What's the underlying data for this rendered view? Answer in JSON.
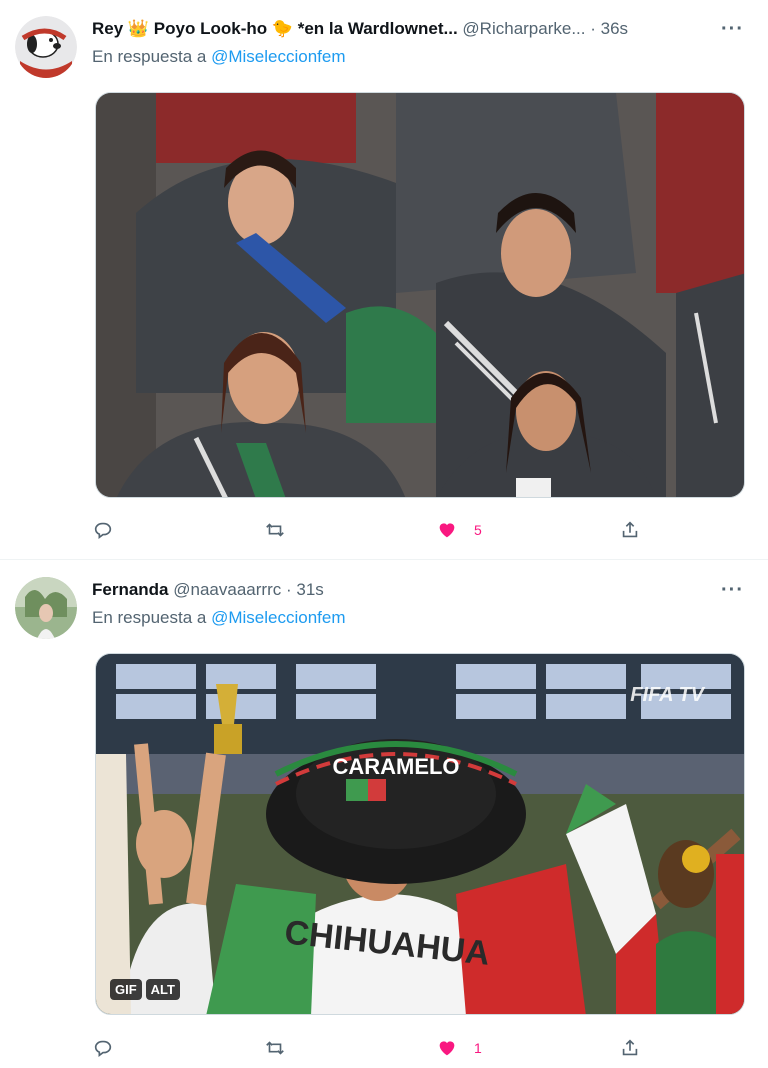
{
  "tweets": [
    {
      "display_name": "Rey 👑 Poyo Look-ho 🐤 *en la Wardlownet...",
      "handle": "@Richarparke...",
      "time": "36s",
      "reply_prefix": "En respuesta a",
      "reply_to": "@Miseleccionfem",
      "more": "···",
      "like_count": "5",
      "media_type": "image"
    },
    {
      "display_name": "Fernanda",
      "handle": "@naavaaarrrc",
      "time": "31s",
      "reply_prefix": "En respuesta a",
      "reply_to": "@Miseleccionfem",
      "more": "···",
      "like_count": "1",
      "media_type": "gif",
      "media_badges": [
        "GIF",
        "ALT"
      ],
      "watermark": "FIFA TV",
      "sombrero_text": "CARAMELO",
      "shirt_text": "CHIHUAHUA"
    }
  ],
  "colors": {
    "like": "#f91880",
    "mention": "#1d9bf0",
    "secondary": "#536471"
  }
}
